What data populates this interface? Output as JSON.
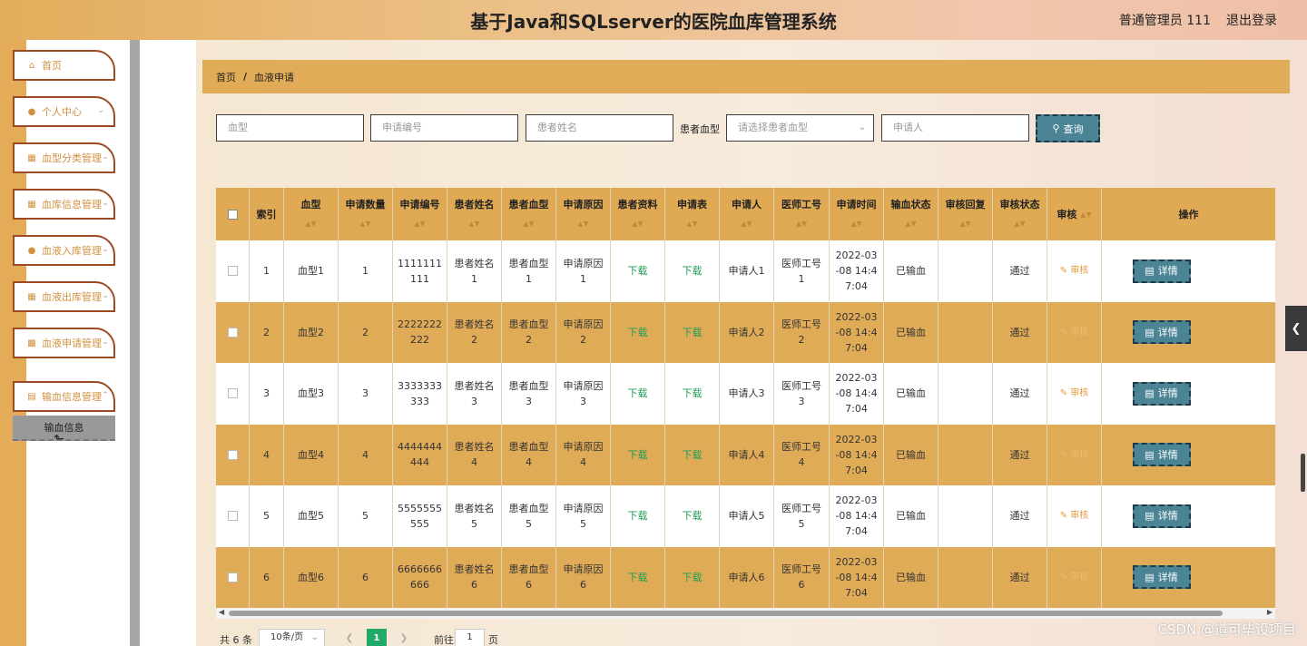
{
  "header": {
    "title": "基于Java和SQLserver的医院血库管理系统",
    "user": "普通管理员 111",
    "logout": "退出登录"
  },
  "sidebar": {
    "items": [
      {
        "label": "首页",
        "icon": "home-icon"
      },
      {
        "label": "个人中心",
        "icon": "user-icon"
      },
      {
        "label": "血型分类管理",
        "icon": "grid-icon"
      },
      {
        "label": "血库信息管理",
        "icon": "grid-icon"
      },
      {
        "label": "血液入库管理",
        "icon": "user-icon"
      },
      {
        "label": "血液出库管理",
        "icon": "grid-icon"
      },
      {
        "label": "血液申请管理",
        "icon": "briefcase-icon"
      },
      {
        "label": "输血信息管理",
        "icon": "clipboard-icon"
      }
    ],
    "submenu_label": "输血信息"
  },
  "breadcrumb": {
    "home": "首页",
    "sep": "/",
    "current": "血液申请"
  },
  "filters": {
    "blood_type_placeholder": "血型",
    "apply_no_placeholder": "申请编号",
    "patient_name_placeholder": "患者姓名",
    "patient_blood_label": "患者血型",
    "patient_blood_placeholder": "请选择患者血型",
    "applicant_placeholder": "申请人",
    "search_label": "查询"
  },
  "table": {
    "columns": [
      "索引",
      "血型",
      "申请数量",
      "申请编号",
      "患者姓名",
      "患者血型",
      "申请原因",
      "患者资料",
      "申请表",
      "申请人",
      "医师工号",
      "申请时间",
      "输血状态",
      "审核回复",
      "审核状态",
      "审核",
      "操作"
    ],
    "rows": [
      {
        "index": "1",
        "blood": "血型1",
        "qty": "1",
        "no1": "1111111",
        "no2": "111",
        "pn1": "患者姓名",
        "pn2": "1",
        "pb1": "患者血型",
        "pb2": "1",
        "rs1": "申请原因",
        "rs2": "1",
        "file": "下载",
        "form": "下载",
        "applicant": "申请人1",
        "dw1": "医师工号",
        "dw2": "1",
        "t1": "2022-03",
        "t2": "-08 14:4",
        "t3": "7:04",
        "status": "已输血",
        "reply": "",
        "review": "通过",
        "audit": "审核",
        "action": "详情"
      },
      {
        "index": "2",
        "blood": "血型2",
        "qty": "2",
        "no1": "2222222",
        "no2": "222",
        "pn1": "患者姓名",
        "pn2": "2",
        "pb1": "患者血型",
        "pb2": "2",
        "rs1": "申请原因",
        "rs2": "2",
        "file": "下载",
        "form": "下载",
        "applicant": "申请人2",
        "dw1": "医师工号",
        "dw2": "2",
        "t1": "2022-03",
        "t2": "-08 14:4",
        "t3": "7:04",
        "status": "已输血",
        "reply": "",
        "review": "通过",
        "audit": "审核",
        "action": "详情"
      },
      {
        "index": "3",
        "blood": "血型3",
        "qty": "3",
        "no1": "3333333",
        "no2": "333",
        "pn1": "患者姓名",
        "pn2": "3",
        "pb1": "患者血型",
        "pb2": "3",
        "rs1": "申请原因",
        "rs2": "3",
        "file": "下载",
        "form": "下载",
        "applicant": "申请人3",
        "dw1": "医师工号",
        "dw2": "3",
        "t1": "2022-03",
        "t2": "-08 14:4",
        "t3": "7:04",
        "status": "已输血",
        "reply": "",
        "review": "通过",
        "audit": "审核",
        "action": "详情"
      },
      {
        "index": "4",
        "blood": "血型4",
        "qty": "4",
        "no1": "4444444",
        "no2": "444",
        "pn1": "患者姓名",
        "pn2": "4",
        "pb1": "患者血型",
        "pb2": "4",
        "rs1": "申请原因",
        "rs2": "4",
        "file": "下载",
        "form": "下载",
        "applicant": "申请人4",
        "dw1": "医师工号",
        "dw2": "4",
        "t1": "2022-03",
        "t2": "-08 14:4",
        "t3": "7:04",
        "status": "已输血",
        "reply": "",
        "review": "通过",
        "audit": "审核",
        "action": "详情"
      },
      {
        "index": "5",
        "blood": "血型5",
        "qty": "5",
        "no1": "5555555",
        "no2": "555",
        "pn1": "患者姓名",
        "pn2": "5",
        "pb1": "患者血型",
        "pb2": "5",
        "rs1": "申请原因",
        "rs2": "5",
        "file": "下载",
        "form": "下载",
        "applicant": "申请人5",
        "dw1": "医师工号",
        "dw2": "5",
        "t1": "2022-03",
        "t2": "-08 14:4",
        "t3": "7:04",
        "status": "已输血",
        "reply": "",
        "review": "通过",
        "audit": "审核",
        "action": "详情"
      },
      {
        "index": "6",
        "blood": "血型6",
        "qty": "6",
        "no1": "6666666",
        "no2": "666",
        "pn1": "患者姓名",
        "pn2": "6",
        "pb1": "患者血型",
        "pb2": "6",
        "rs1": "申请原因",
        "rs2": "6",
        "file": "下载",
        "form": "下载",
        "applicant": "申请人6",
        "dw1": "医师工号",
        "dw2": "6",
        "t1": "2022-03",
        "t2": "-08 14:4",
        "t3": "7:04",
        "status": "已输血",
        "reply": "",
        "review": "通过",
        "audit": "审核",
        "action": "详情"
      }
    ]
  },
  "pagination": {
    "total": "共 6 条",
    "page_size": "10条/页",
    "current_page": "1",
    "goto_label": "前往",
    "goto_value": "1",
    "page_unit": "页"
  },
  "watermark": "CSDN @道可毕设项目",
  "colors": {
    "accent": "#e0ab57",
    "button": "#4b8595",
    "link_green": "#1f9d55"
  }
}
